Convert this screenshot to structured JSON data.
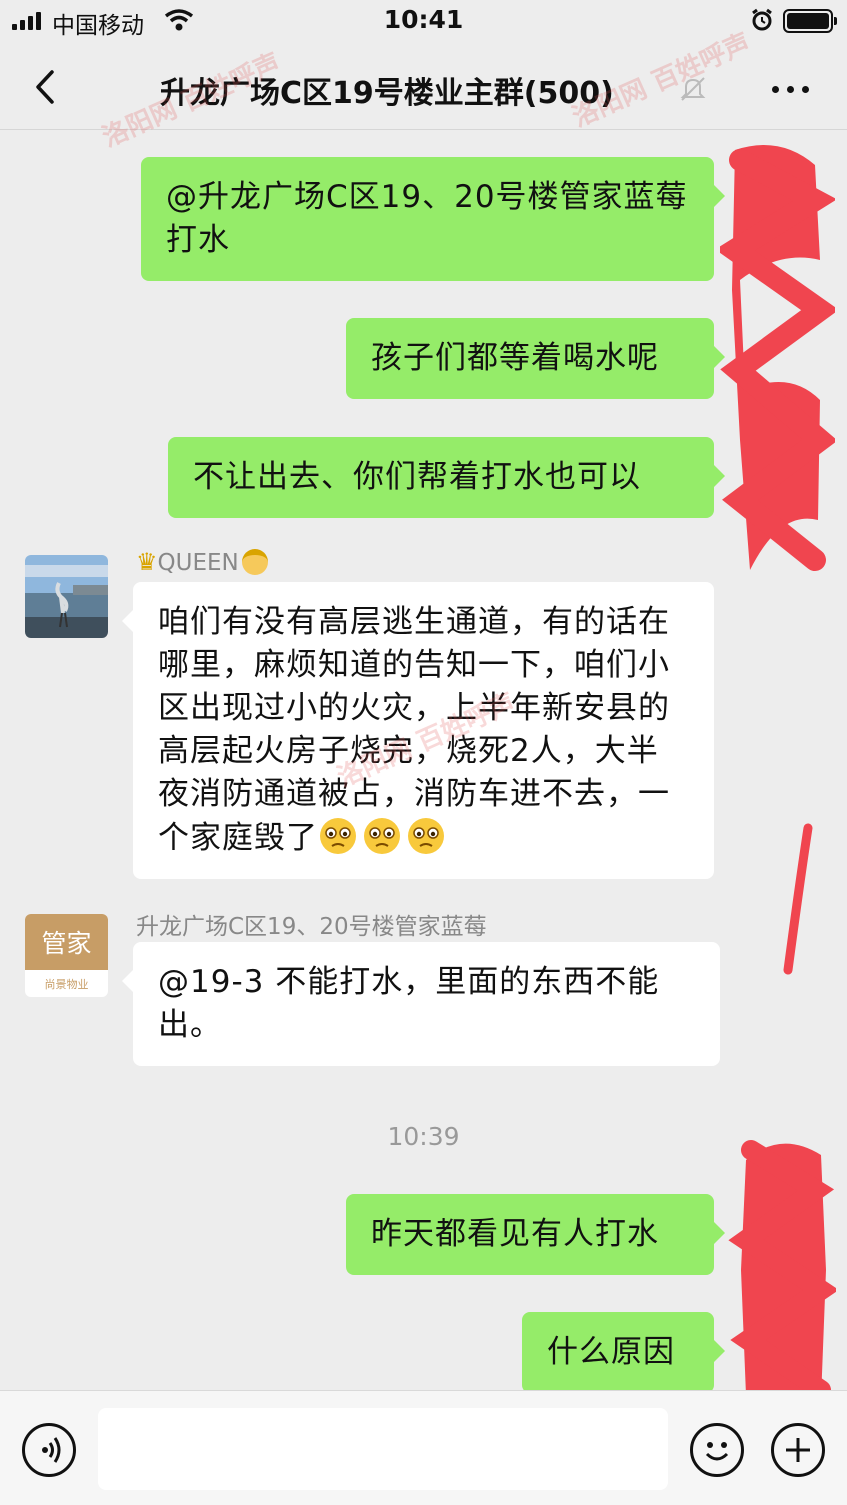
{
  "status_bar": {
    "carrier": "中国移动",
    "time": "10:41"
  },
  "header": {
    "title": "升龙广场C区19号楼业主群(500)",
    "back_icon": "chevron-left-icon",
    "menu_icon": "more-dots-icon"
  },
  "messages": [
    {
      "from": "me",
      "text": "@升龙广场C区19、20号楼管家蓝莓 打水"
    },
    {
      "from": "me",
      "text": "孩子们都等着喝水呢"
    },
    {
      "from": "me",
      "text": "不让出去、你们帮着打水也可以"
    },
    {
      "from": "other",
      "sender": "QUEEN",
      "text": "咱们有没有高层逃生通道，有的话在哪里，麻烦知道的告知一下，咱们小区出现过小的火灾，上半年新安县的高层起火房子烧完，烧死2人，大半夜消防通道被占，消防车进不去，一个家庭毁了",
      "emoji": "worried-face-icon"
    },
    {
      "from": "other",
      "sender": "升龙广场C区19、20号楼管家蓝莓",
      "avatar_text": "管家",
      "avatar_brand": "尚景物业",
      "text": "@19-3 不能打水，里面的东西不能出。"
    },
    {
      "from": "me",
      "text": "昨天都看见有人打水"
    },
    {
      "from": "me",
      "text": "什么原因"
    }
  ],
  "timestamp": "10:39",
  "input_bar": {
    "voice_icon": "voice-icon",
    "emoji_icon": "emoji-icon",
    "add_icon": "plus-icon",
    "placeholder": ""
  },
  "watermark": {
    "logo": "洛阳网",
    "label": "百姓呼声"
  },
  "colors": {
    "my_bubble": "#95ec69",
    "other_bubble": "#ffffff",
    "background": "#ededed",
    "redaction": "#f0454f"
  }
}
